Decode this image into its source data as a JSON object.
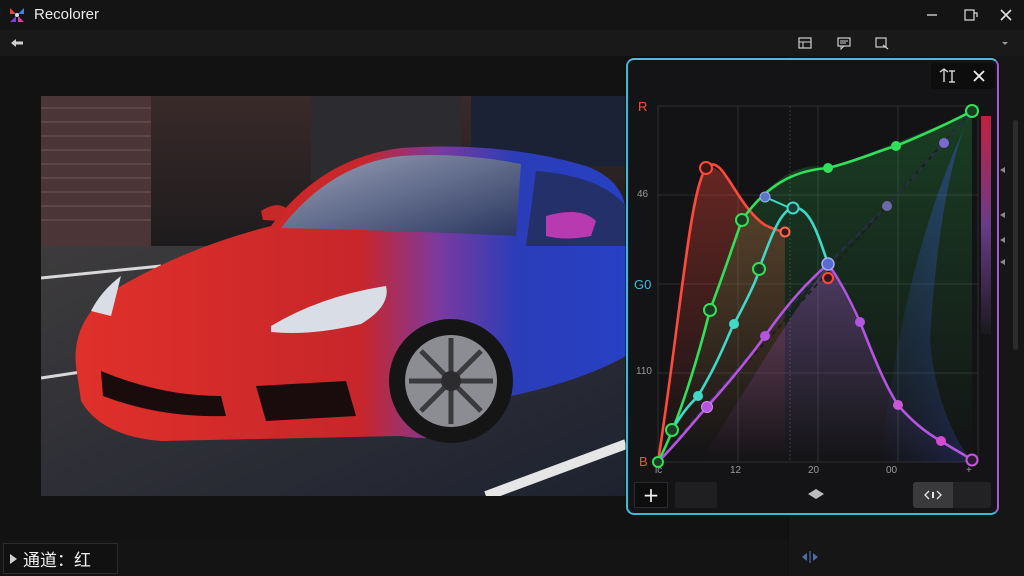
{
  "app": {
    "title": "Recolorer"
  },
  "status": {
    "channel_label": "通道：红"
  },
  "curve_panel": {
    "y_labels": {
      "top": "R",
      "mid": "G0",
      "bottom": "B"
    },
    "y_ticks": [
      "46",
      "110"
    ],
    "x_ticks": [
      "lc",
      "12",
      "20",
      "00",
      "+"
    ],
    "add_label": "+"
  },
  "colors": {
    "red": "#ff4a3a",
    "green": "#31e05a",
    "teal": "#3fd9c8",
    "purple": "#b454e0",
    "blue": "#3c5be0",
    "accent": "#3bb9d9"
  },
  "icons": [
    "back-arrow-icon",
    "minimize-icon",
    "restore-icon",
    "close-icon",
    "layout-icon",
    "comment-icon",
    "export-icon",
    "sort-icon",
    "move-icon"
  ]
}
